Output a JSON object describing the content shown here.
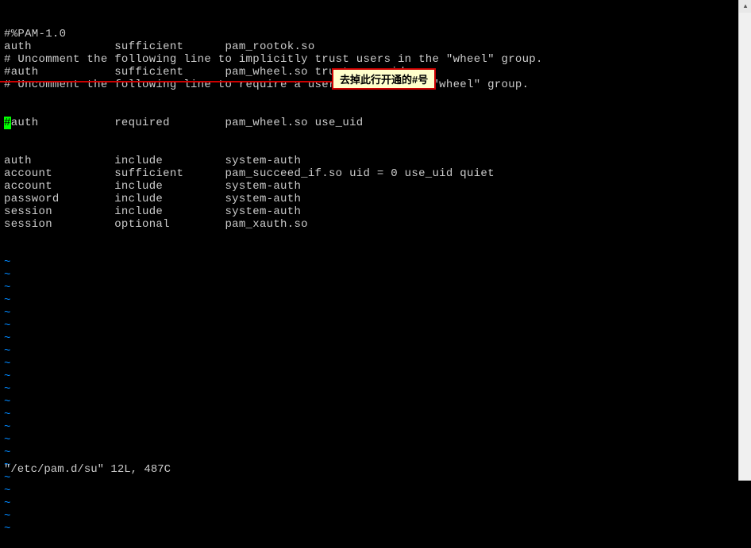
{
  "lines": [
    "#%PAM-1.0",
    "auth            sufficient      pam_rootok.so",
    "# Uncomment the following line to implicitly trust users in the \"wheel\" group.",
    "#auth           sufficient      pam_wheel.so trust use_uid",
    "# Uncomment the following line to require a user to be in the \"wheel\" group."
  ],
  "cursor_line": {
    "hash": "#",
    "rest": "auth           required        pam_wheel.so use_uid"
  },
  "lines_after": [
    "auth            include         system-auth",
    "account         sufficient      pam_succeed_if.so uid = 0 use_uid quiet",
    "account         include         system-auth",
    "password        include         system-auth",
    "session         include         system-auth",
    "session         optional        pam_xauth.so"
  ],
  "tilde": "~",
  "tilde_count": 22,
  "status": "\"/etc/pam.d/su\" 12L, 487C",
  "callout_text": "去掉此行开通的#号",
  "scroll_up_glyph": "▴"
}
